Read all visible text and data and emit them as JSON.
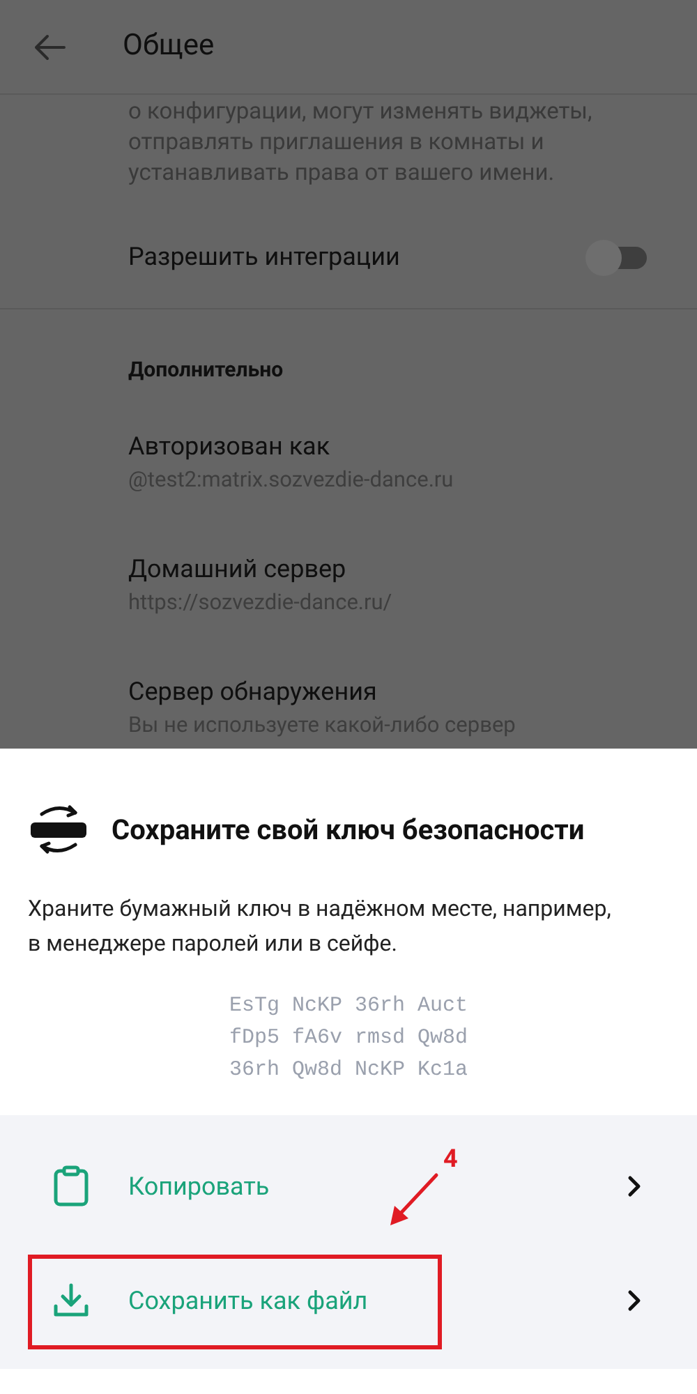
{
  "header": {
    "title": "Общее"
  },
  "settings": {
    "truncated_description": "о конфигурации, могут изменять виджеты, отправлять приглашения в комнаты и устанавливать права от вашего имени.",
    "toggle": {
      "label": "Разрешить интеграции",
      "on": false
    },
    "section_title": "Дополнительно",
    "items": [
      {
        "title": "Авторизован как",
        "subtitle": "@test2:matrix.sozvezdie-dance.ru"
      },
      {
        "title": "Домашний сервер",
        "subtitle": "https://sozvezdie-dance.ru/"
      },
      {
        "title": "Сервер обнаружения",
        "subtitle": "Вы не используете какой-либо сервер"
      }
    ]
  },
  "sheet": {
    "title": "Сохраните свой ключ безопасности",
    "description": "Храните бумажный ключ в надёжном месте, например, в менеджере паролей или в сейфе.",
    "key_lines": [
      "EsTg NcKP 36rh Auct",
      "fDp5 fA6v rmsd Qw8d",
      "36rh Qw8d NcKP Kc1a"
    ],
    "actions": [
      {
        "kind": "copy",
        "label": "Копировать",
        "highlighted": false
      },
      {
        "kind": "download",
        "label": "Сохранить как файл",
        "highlighted": true
      }
    ]
  },
  "annotation": {
    "label": "4"
  }
}
